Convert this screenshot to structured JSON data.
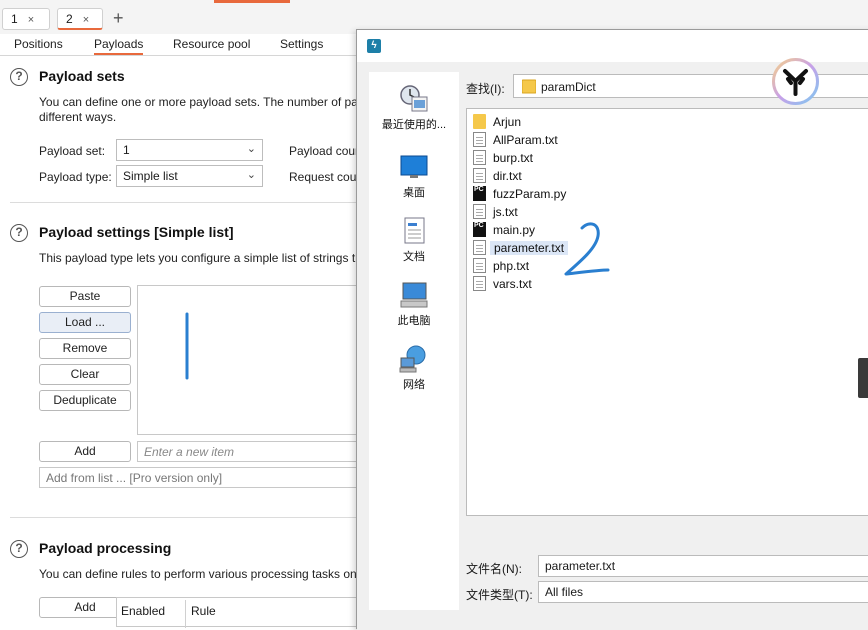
{
  "tabs": [
    {
      "label": "1",
      "close": "×"
    },
    {
      "label": "2",
      "close": "×"
    }
  ],
  "new_tab": "+",
  "subtabs": [
    "Positions",
    "Payloads",
    "Resource pool",
    "Settings"
  ],
  "payload_sets": {
    "title": "Payload sets",
    "desc_line1": "You can define one or more payload sets. The number of pay",
    "desc_line2": "different ways.",
    "set_label": "Payload set:",
    "set_value": "1",
    "type_label": "Payload type:",
    "type_value": "Simple list",
    "count_label": "Payload cour",
    "request_label": "Request cour"
  },
  "payload_settings": {
    "title": "Payload settings [Simple list]",
    "desc": "This payload type lets you configure a simple list of strings th",
    "buttons": [
      "Paste",
      "Load ...",
      "Remove",
      "Clear",
      "Deduplicate"
    ],
    "add_label": "Add",
    "new_item_placeholder": "Enter a new item",
    "add_from_list": "Add from list ... [Pro version only]"
  },
  "payload_processing": {
    "title": "Payload processing",
    "desc": "You can define rules to perform various processing tasks on c",
    "add_label": "Add",
    "col_enabled": "Enabled",
    "col_rule": "Rule"
  },
  "dialog": {
    "look_in_label": "查找(I):",
    "look_in_value": "paramDict",
    "places": [
      "最近使用的...",
      "桌面",
      "文档",
      "此电脑",
      "网络"
    ],
    "files": [
      {
        "name": "Arjun",
        "kind": "folder"
      },
      {
        "name": "AllParam.txt",
        "kind": "doc"
      },
      {
        "name": "burp.txt",
        "kind": "doc"
      },
      {
        "name": "dir.txt",
        "kind": "doc"
      },
      {
        "name": "fuzzParam.py",
        "kind": "pycharm"
      },
      {
        "name": "js.txt",
        "kind": "doc"
      },
      {
        "name": "main.py",
        "kind": "pycharm"
      },
      {
        "name": "parameter.txt",
        "kind": "doc",
        "selected": true
      },
      {
        "name": "php.txt",
        "kind": "doc"
      },
      {
        "name": "vars.txt",
        "kind": "doc"
      }
    ],
    "filename_label": "文件名(N):",
    "filename_value": "parameter.txt",
    "filetype_label": "文件类型(T):",
    "filetype_value": "All files"
  },
  "colors": {
    "accent": "#e8693c",
    "annotation": "#2a7fd0",
    "selection": "#dbe6f6"
  }
}
